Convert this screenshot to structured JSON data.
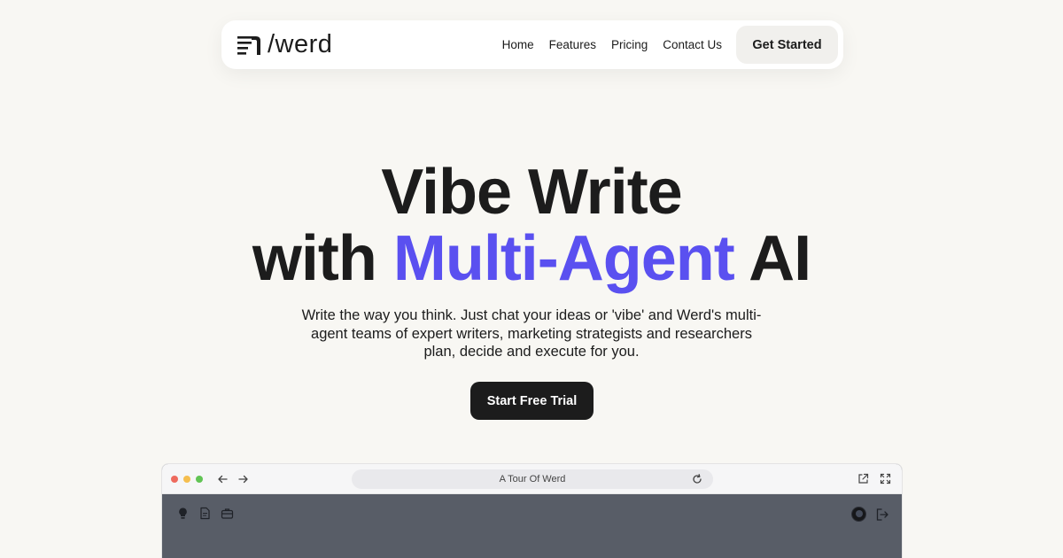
{
  "nav": {
    "brand": "/werd",
    "links": [
      "Home",
      "Features",
      "Pricing",
      "Contact Us"
    ],
    "cta": "Get Started"
  },
  "hero": {
    "title_line1": "Vibe Write",
    "title_line2_prefix": "with ",
    "title_line2_accent": "Multi-Agent",
    "title_line2_suffix": " AI",
    "subtitle": "Write the way you think. Just chat your ideas or 'vibe' and Werd's multi-agent teams of expert writers, marketing strategists and researchers plan, decide and execute for you.",
    "cta": "Start Free Trial"
  },
  "browser": {
    "url_title": "A Tour Of Werd"
  },
  "colors": {
    "accent": "#5a50f0",
    "background": "#f8f7f3",
    "dark": "#1c1c1c"
  },
  "icons": {
    "brand": "document-lines-icon",
    "app_left": [
      "lightbulb-icon",
      "document-icon",
      "briefcase-icon"
    ],
    "app_right": [
      "avatar",
      "logout-icon"
    ],
    "browser_right": [
      "external-link-icon",
      "fullscreen-icon"
    ]
  }
}
